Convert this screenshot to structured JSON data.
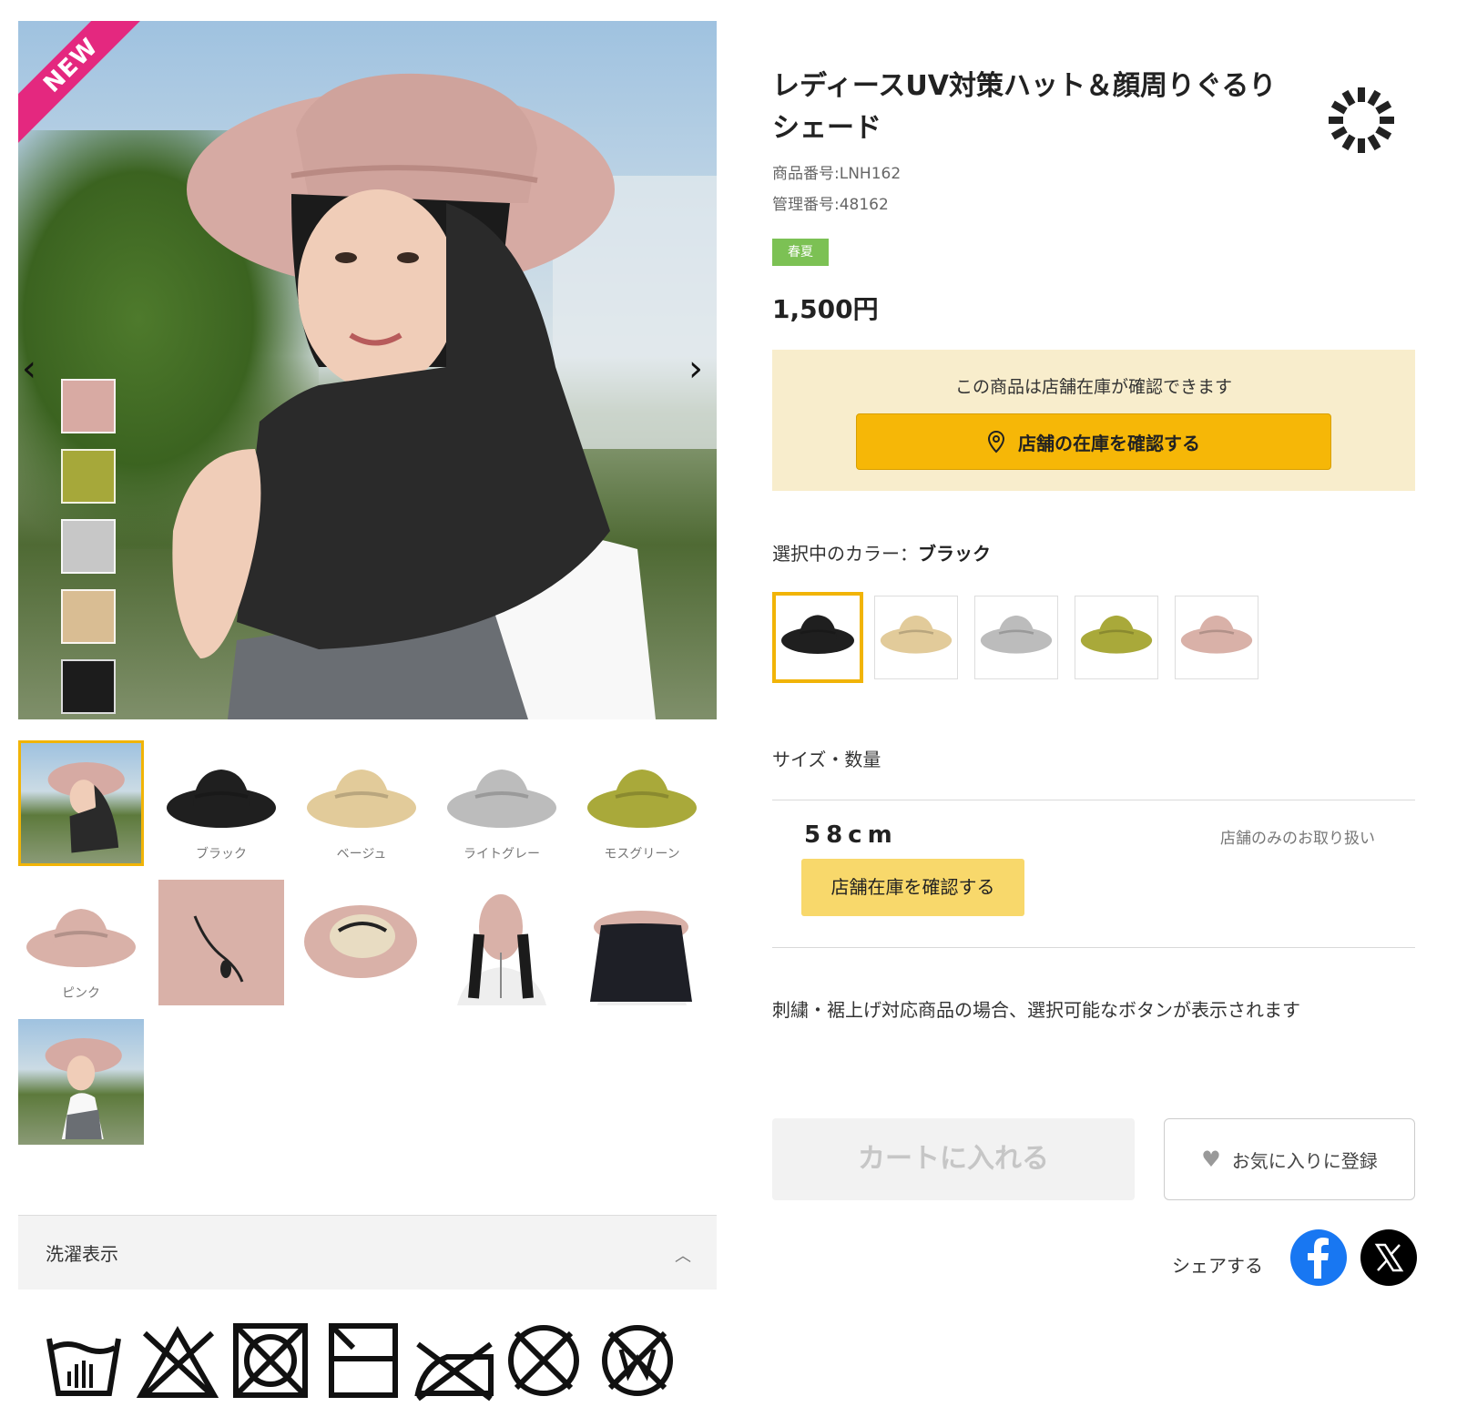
{
  "gallery": {
    "badge": "NEW",
    "prev_glyph": "‹",
    "next_glyph": "›",
    "side_swatches": [
      {
        "name": "pink",
        "color": "#d8aaa3"
      },
      {
        "name": "moss-green",
        "color": "#a6a83a"
      },
      {
        "name": "light-gray",
        "color": "#c7c7c7"
      },
      {
        "name": "beige",
        "color": "#d9bd93"
      },
      {
        "name": "black",
        "color": "#1c1c1c"
      }
    ],
    "thumbnails": [
      {
        "label": "",
        "kind": "model"
      },
      {
        "label": "ブラック",
        "kind": "hat",
        "color": "#1f1f1f"
      },
      {
        "label": "ベージュ",
        "kind": "hat",
        "color": "#e2cb9a"
      },
      {
        "label": "ライトグレー",
        "kind": "hat",
        "color": "#bcbcbc"
      },
      {
        "label": "モスグリーン",
        "kind": "hat",
        "color": "#a9a93a"
      },
      {
        "label": "ピンク",
        "kind": "hat",
        "color": "#d9b1a8"
      },
      {
        "label": "",
        "kind": "detail-cord"
      },
      {
        "label": "",
        "kind": "detail-inside"
      },
      {
        "label": "",
        "kind": "mannequin-front"
      },
      {
        "label": "",
        "kind": "mannequin-back"
      },
      {
        "label": "",
        "kind": "model-2"
      }
    ]
  },
  "laundry": {
    "title": "洗濯表示",
    "chevron": "︿",
    "icons": [
      "hand-wash-icon",
      "no-bleach-icon",
      "no-tumble-dry-icon",
      "line-dry-shade-icon",
      "no-iron-icon",
      "no-dry-clean-icon",
      "no-wet-clean-icon"
    ]
  },
  "product": {
    "title": "レディースUV対策ハット＆顔周りぐるりシェード",
    "product_number": "商品番号:LNH162",
    "management_number": "管理番号:48162",
    "season_badge": "春夏",
    "season_color": "#7cc154",
    "price": "1,500円"
  },
  "store_stock": {
    "note": "この商品は店舗在庫が確認できます",
    "button": "店舗の在庫を確認する"
  },
  "color": {
    "label": "選択中のカラー：",
    "selected": "ブラック",
    "options": [
      {
        "name": "ブラック",
        "color": "#1f1f1f",
        "selected": true
      },
      {
        "name": "ベージュ",
        "color": "#e2cb9a",
        "selected": false
      },
      {
        "name": "ライトグレー",
        "color": "#bcbcbc",
        "selected": false
      },
      {
        "name": "モスグリーン",
        "color": "#a9a93a",
        "selected": false
      },
      {
        "name": "ピンク",
        "color": "#d9b1a8",
        "selected": false
      }
    ]
  },
  "size": {
    "label": "サイズ・数量",
    "value": "58cm",
    "store_only": "店舗のみのお取り扱い",
    "stock_button": "店舗在庫を確認する"
  },
  "embroidery_note": "刺繍・裾上げ対応商品の場合、選択可能なボタンが表示されます",
  "actions": {
    "cart": "カートに入れる",
    "favorite": "お気に入りに登録",
    "share": "シェアする"
  },
  "colors": {
    "accent": "#f1b407",
    "stock_bg": "#f8edcc",
    "facebook": "#1877f2",
    "x": "#000000"
  }
}
